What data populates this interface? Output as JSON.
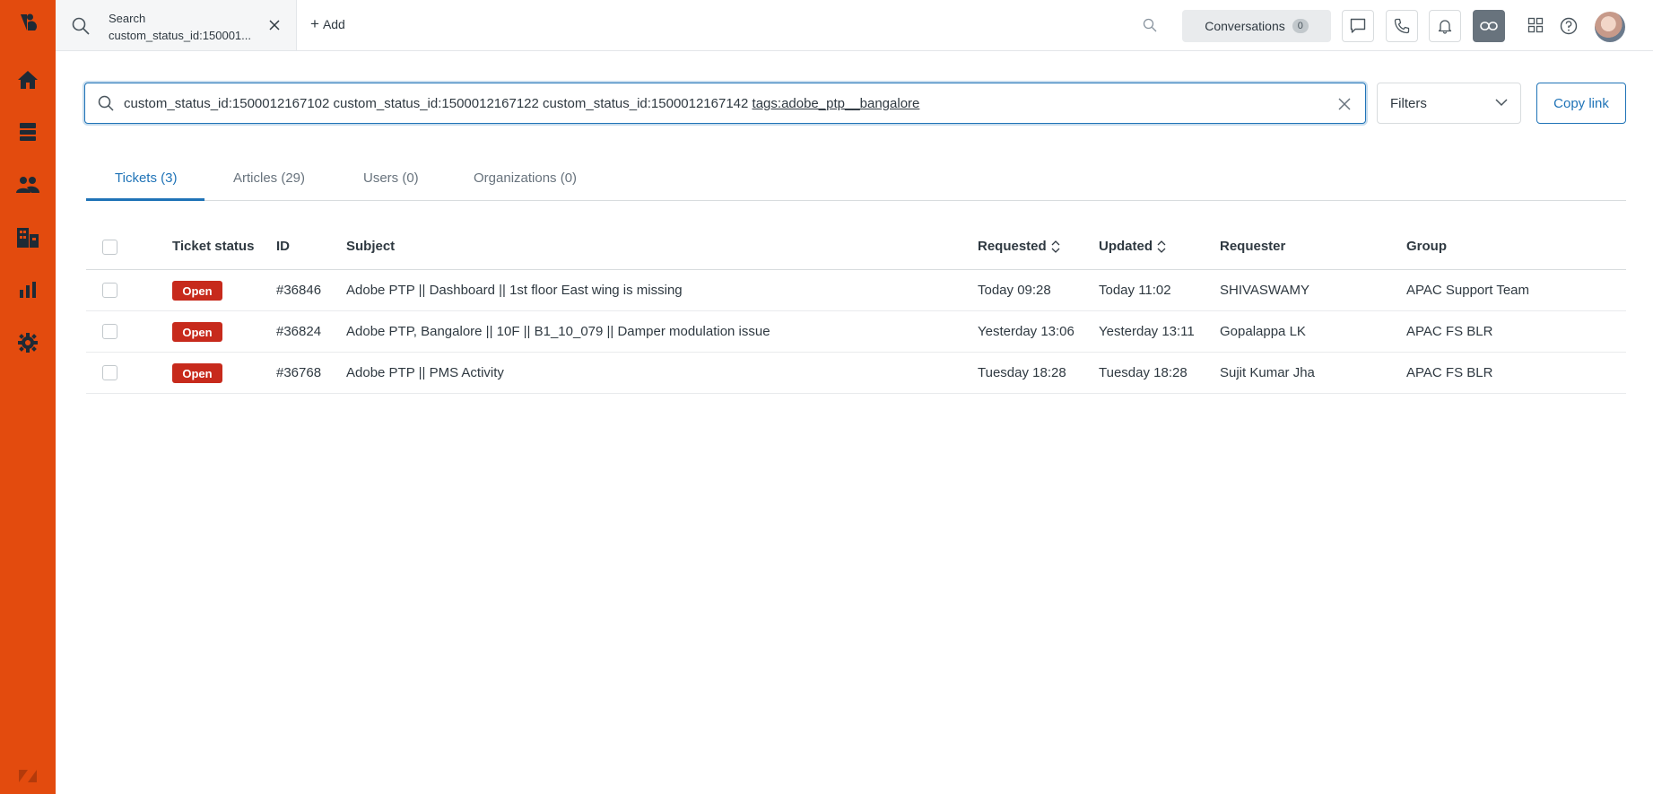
{
  "nav": {
    "items": [
      "logo-icon",
      "home-icon",
      "views-icon",
      "customers-icon",
      "organizations-icon",
      "reporting-icon",
      "admin-icon",
      "zendesk-icon"
    ],
    "bg_color": "#e34b0e"
  },
  "topbar": {
    "tab": {
      "title": "Search",
      "subtitle": "custom_status_id:150001..."
    },
    "add_label": "Add",
    "conversations": {
      "label": "Conversations",
      "count": "0"
    }
  },
  "search": {
    "query_main": "custom_status_id:1500012167102 custom_status_id:1500012167122 custom_status_id:1500012167142 ",
    "query_tag": "tags:adobe_ptp__bangalore",
    "filters_label": "Filters",
    "copy_link_label": "Copy link"
  },
  "result_tabs": [
    {
      "label": "Tickets (3)",
      "selected": true
    },
    {
      "label": "Articles (29)",
      "selected": false
    },
    {
      "label": "Users (0)",
      "selected": false
    },
    {
      "label": "Organizations (0)",
      "selected": false
    }
  ],
  "table": {
    "columns": {
      "status": "Ticket status",
      "id": "ID",
      "subject": "Subject",
      "requested": "Requested",
      "updated": "Updated",
      "requester": "Requester",
      "group": "Group"
    },
    "rows": [
      {
        "status": "Open",
        "id": "#36846",
        "subject": "Adobe PTP || Dashboard || 1st floor East wing is missing",
        "requested": "Today 09:28",
        "updated": "Today 11:02",
        "requester": "SHIVASWAMY",
        "group": "APAC Support Team"
      },
      {
        "status": "Open",
        "id": "#36824",
        "subject": "Adobe PTP, Bangalore || 10F || B1_10_079 || Damper modulation issue",
        "requested": "Yesterday 13:06",
        "updated": "Yesterday 13:11",
        "requester": "Gopalappa LK",
        "group": "APAC FS BLR"
      },
      {
        "status": "Open",
        "id": "#36768",
        "subject": "Adobe PTP || PMS Activity",
        "requested": "Tuesday 18:28",
        "updated": "Tuesday 18:28",
        "requester": "Sujit Kumar Jha",
        "group": "APAC FS BLR"
      }
    ]
  },
  "colors": {
    "accent": "#1f73b7",
    "open_badge": "#c72a1c"
  }
}
